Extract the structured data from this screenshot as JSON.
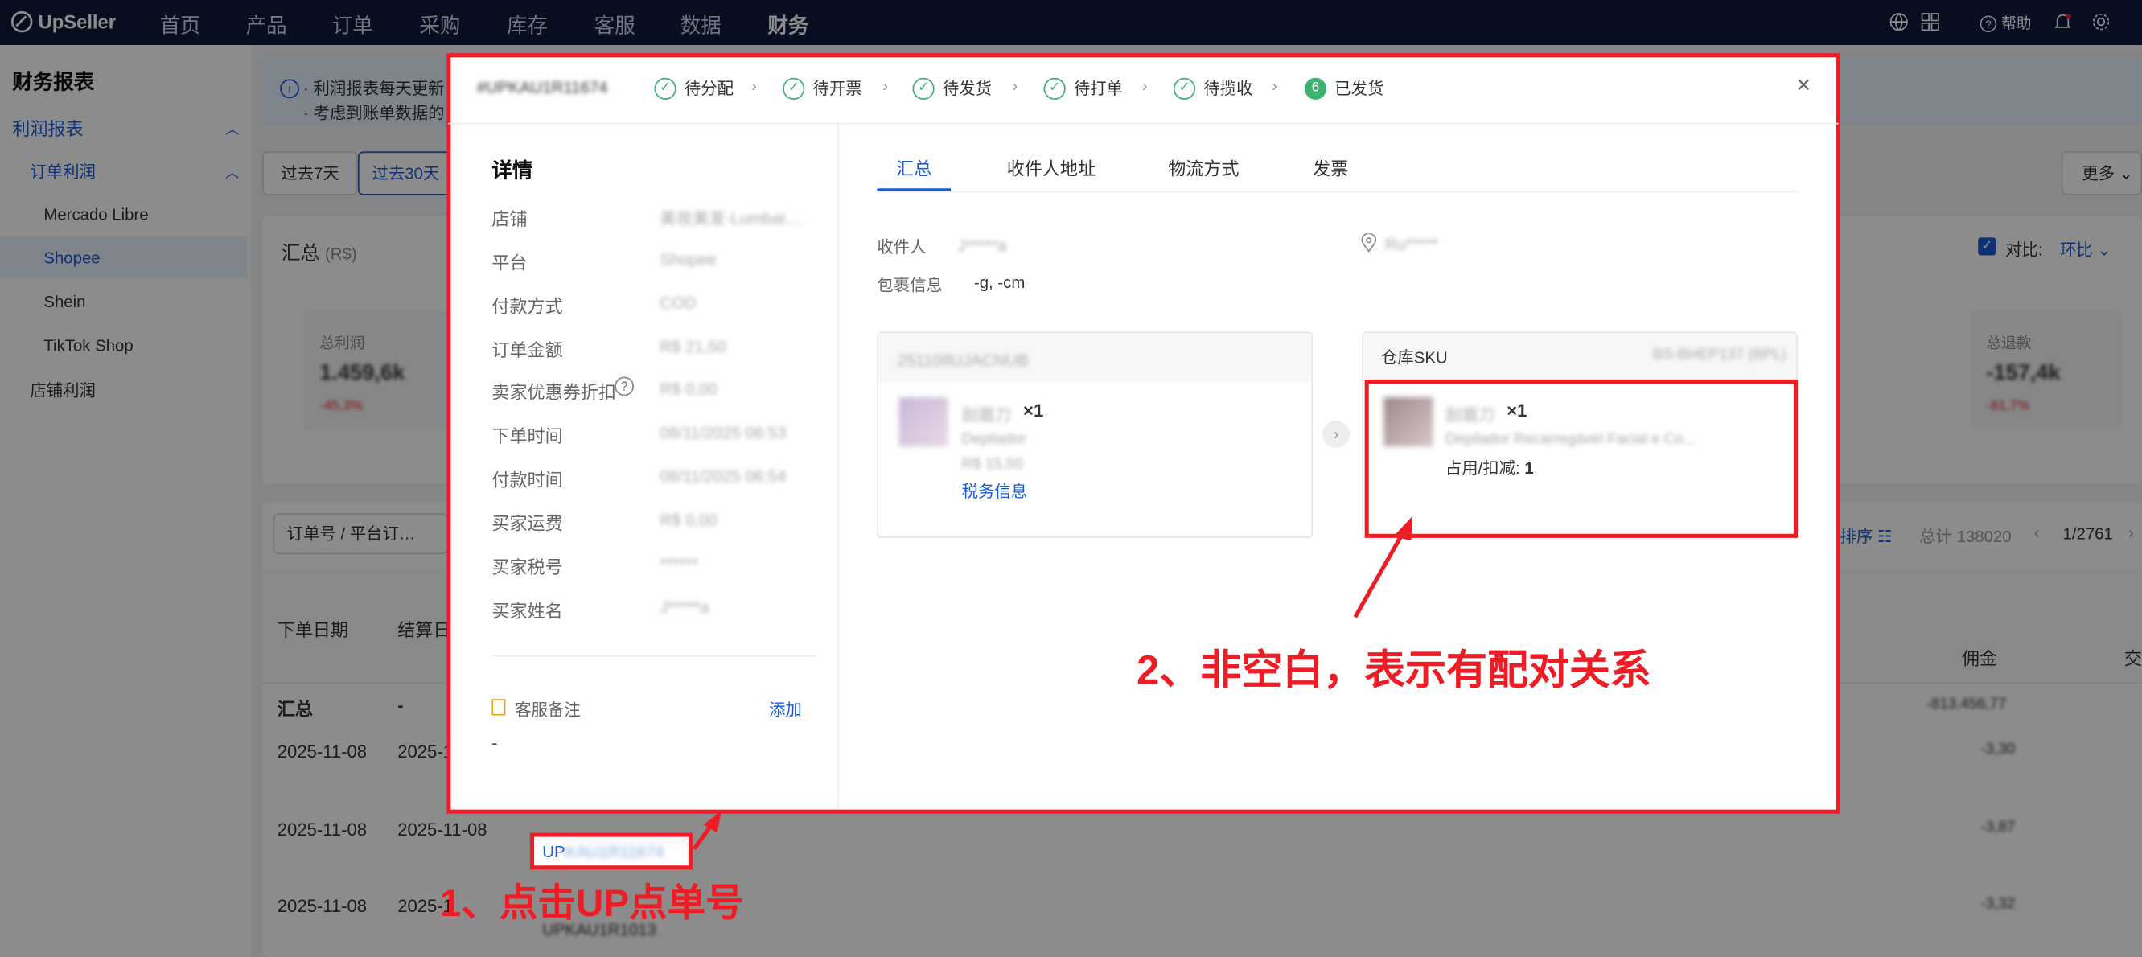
{
  "topbar": {
    "brand": "UpSeller",
    "nav": [
      "首页",
      "产品",
      "订单",
      "采购",
      "库存",
      "客服",
      "数据",
      "财务"
    ],
    "active_nav": "财务",
    "help": "帮助"
  },
  "sidebar": {
    "title": "财务报表",
    "group": "利润报表",
    "subgroup": "订单利润",
    "items": [
      "Mercado Libre",
      "Shopee",
      "Shein",
      "TikTok Shop"
    ],
    "selected": "Shopee",
    "other": "店铺利润"
  },
  "background": {
    "info_line1": "· 利润报表每天更新",
    "info_line2": "· 考虑到账单数据的",
    "range_tabs": [
      "过去7天",
      "过去30天"
    ],
    "more": "更多",
    "summary_title": "汇总",
    "summary_unit": "(R$)",
    "compare_label": "对比:",
    "compare_value": "环比",
    "metric_total_profit": "总利润",
    "metric_total_profit_value": "1.459,6k",
    "metric_total_profit_delta": "-45,3%",
    "metric_refund": "总退款",
    "metric_refund_value": "-157,4k",
    "metric_refund_delta": "-81,7%",
    "search_field": "订单号 / 平台订…",
    "sort_label": "排序",
    "total": "总计 138020",
    "pager": "1/2761",
    "col_order_date": "下单日期",
    "col_settle_date": "结算日",
    "col_commission": "佣金",
    "col_trade": "交",
    "summary_row_label": "汇总",
    "summary_row_dash": "-",
    "summary_row_commission": "-813.456,77",
    "rows": [
      {
        "date": "2025-11-08",
        "settle": "2025-1",
        "commission": "-3,30"
      },
      {
        "date": "2025-11-08",
        "settle": "2025-11-08",
        "order": "UP",
        "commission": "-3,87"
      },
      {
        "date": "2025-11-08",
        "settle": "2025-1",
        "order": "UPKAU1R1013",
        "commission": "-3,32"
      }
    ]
  },
  "modal": {
    "order_id": "#UPKAU1R11674",
    "steps": [
      "待分配",
      "待开票",
      "待发货",
      "待打单",
      "待揽收"
    ],
    "final_step_num": "6",
    "final_step": "已发货",
    "detail_title": "详情",
    "fields": [
      {
        "label": "店铺",
        "value": "美妆美发-Lumbat…"
      },
      {
        "label": "平台",
        "value": "Shopee"
      },
      {
        "label": "付款方式",
        "value": "COD"
      },
      {
        "label": "订单金额",
        "value": "R$ 21,50"
      },
      {
        "label": "卖家优惠券折扣",
        "value": "R$ 0,00"
      },
      {
        "label": "下单时间",
        "value": "08/11/2025 06:53"
      },
      {
        "label": "付款时间",
        "value": "08/11/2025 06:54"
      },
      {
        "label": "买家运费",
        "value": "R$ 0,00"
      },
      {
        "label": "买家税号",
        "value": "******"
      },
      {
        "label": "买家姓名",
        "value": "J*****a"
      }
    ],
    "note_title": "客服备注",
    "note_add": "添加",
    "note_value": "-",
    "tabs": [
      "汇总",
      "收件人地址",
      "物流方式",
      "发票"
    ],
    "active_tab": "汇总",
    "recipient_label": "收件人",
    "recipient_value": "J*****a",
    "package_label": "包裹信息",
    "package_value": "-g, -cm",
    "location_value": "Ru*****",
    "left_card_header": "251108UJACNUB",
    "left_item_name": "刮眉刀",
    "left_item_qty": "×1",
    "left_item_sub": "Depilador",
    "left_item_price": "R$ 15,50",
    "tax_link": "税务信息",
    "right_card_header": "仓库SKU",
    "right_card_header_value": "BS-BHEP137 (BPL)",
    "right_item_name": "刮眉刀",
    "right_item_qty": "×1",
    "right_item_sub": "Depilador Recarregável Facial e Co...",
    "right_item_occupy_label": "占用/扣减:",
    "right_item_occupy_value": "1",
    "close": "×"
  },
  "annotations": {
    "step1": "1、点击UP点单号",
    "step2": "2、非空白，表示有配对关系"
  },
  "colors": {
    "highlight": "#ee1c25",
    "topbar": "#0b1a3a",
    "brand_blue": "#1a5bd8",
    "success": "#3cb371"
  }
}
